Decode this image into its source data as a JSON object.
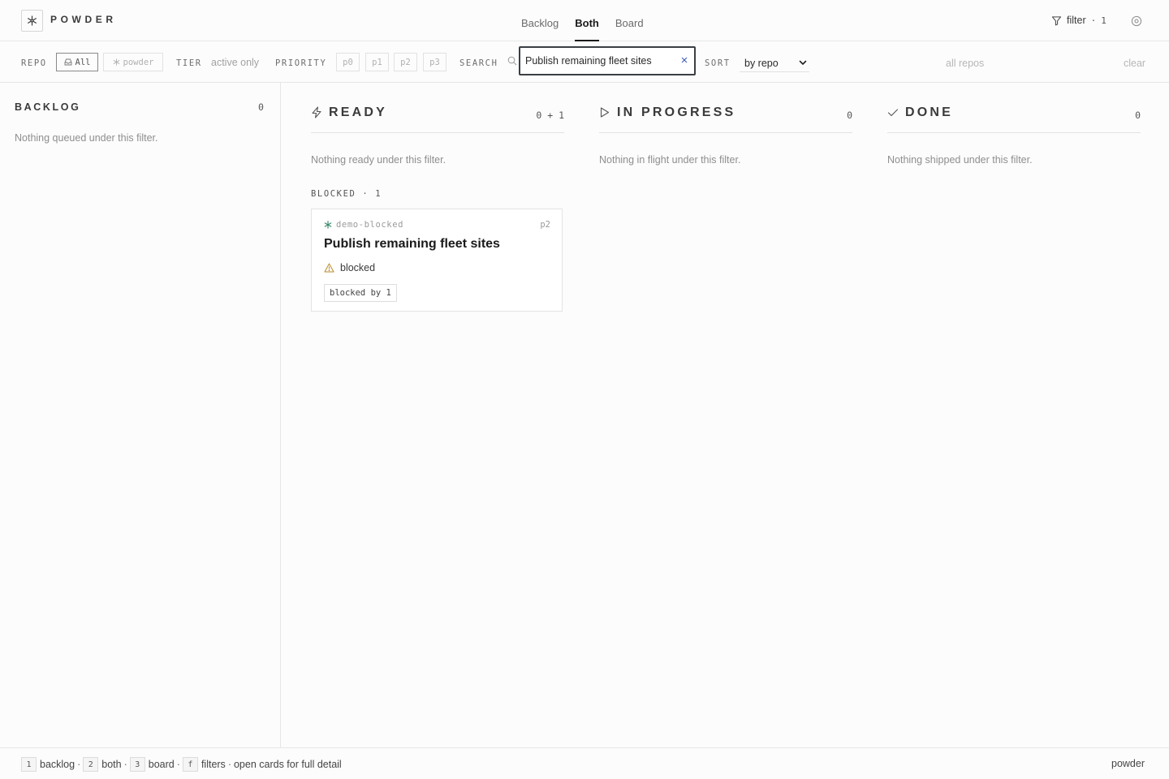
{
  "app": {
    "brand": "POWDER"
  },
  "views": [
    {
      "label": "Backlog",
      "active": false
    },
    {
      "label": "Both",
      "active": true
    },
    {
      "label": "Board",
      "active": false
    }
  ],
  "header": {
    "filter_label": "filter",
    "filter_sep": "·",
    "filter_count": "1"
  },
  "filters": {
    "repo_label": "REPO",
    "repo_options": [
      {
        "label": "All",
        "icon": "inbox-icon",
        "selected": true
      },
      {
        "label": "powder",
        "icon": "snowflake-icon",
        "selected": false
      }
    ],
    "tier_label": "TIER",
    "tier_value": "active only",
    "priority_label": "PRIORITY",
    "priority_options": [
      "p0",
      "p1",
      "p2",
      "p3"
    ],
    "search_label": "SEARCH",
    "search_value": "Publish remaining fleet sites",
    "search_clear": "×",
    "sort_label": "SORT",
    "sort_value": "by repo",
    "scope_text": "all repos",
    "clear_label": "clear"
  },
  "backlog": {
    "title": "BACKLOG",
    "count": "0",
    "empty_text": "Nothing queued under this filter."
  },
  "columns": {
    "ready": {
      "title": "READY",
      "count": "0 + 1",
      "icon": "lightning-icon",
      "empty_text": "Nothing ready under this filter."
    },
    "in_progress": {
      "title": "IN PROGRESS",
      "count": "0",
      "icon": "play-icon",
      "empty_text": "Nothing in flight under this filter."
    },
    "done": {
      "title": "DONE",
      "count": "0",
      "icon": "check-icon",
      "empty_text": "Nothing shipped under this filter."
    }
  },
  "blocked": {
    "heading": "BLOCKED · 1",
    "card": {
      "repo": "demo-blocked",
      "priority": "p2",
      "title": "Publish remaining fleet sites",
      "status": "blocked",
      "tag": "blocked by 1"
    }
  },
  "footer": {
    "shortcuts": [
      {
        "key": "1",
        "label": "backlog"
      },
      {
        "key": "2",
        "label": "both"
      },
      {
        "key": "3",
        "label": "board"
      },
      {
        "key": "f",
        "label": "filters"
      }
    ],
    "sep": "·",
    "hint": "open cards for full detail",
    "right": "powder"
  },
  "colors": {
    "accent_text": "#1a1a1a",
    "clear_x": "#3b5bb5",
    "repo_icon": "#3a8a6a",
    "blocked_icon": "#b88a2a"
  }
}
